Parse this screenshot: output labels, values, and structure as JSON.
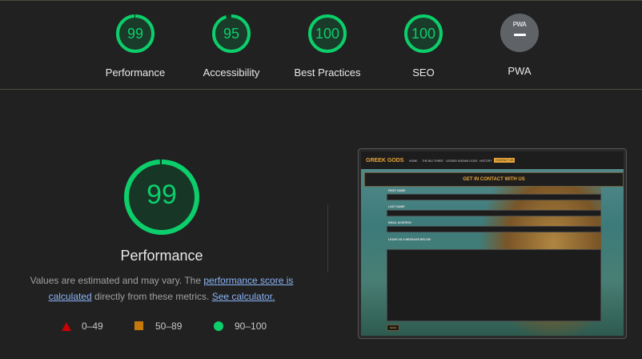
{
  "categories": [
    {
      "name": "Performance",
      "score": "99",
      "fraction": 0.99
    },
    {
      "name": "Accessibility",
      "score": "95",
      "fraction": 0.95
    },
    {
      "name": "Best Practices",
      "score": "100",
      "fraction": 1.0
    },
    {
      "name": "SEO",
      "score": "100",
      "fraction": 1.0
    }
  ],
  "pwa": {
    "badge_text": "PWA",
    "label": "PWA"
  },
  "main": {
    "score": "99",
    "fraction": 0.99,
    "title": "Performance",
    "desc_prefix": "Values are estimated and may vary. The ",
    "desc_link1": "performance score is calculated",
    "desc_mid": " directly from these metrics. ",
    "desc_link2": "See calculator."
  },
  "legend": {
    "fail": "0–49",
    "average": "50–89",
    "pass": "90–100"
  },
  "colors": {
    "pass": "#0cce6b",
    "average": "#c47a0b",
    "fail": "#cc0000",
    "background": "#212121"
  },
  "screenshot": {
    "brand": "GREEK GODS",
    "nav_links": [
      "HOME",
      "THE BIG THREE",
      "LESSER KNOWN GODS",
      "HISTORY",
      "CONTACT US"
    ],
    "active_nav": "CONTACT US",
    "form_title": "GET IN CONTACT WITH US",
    "fields": [
      "FIRST NAME",
      "LAST NAME",
      "EMAIL ADDRESS"
    ],
    "message_label": "LEAVE US A MESSAGE BELOW",
    "send_label": "SEND"
  }
}
